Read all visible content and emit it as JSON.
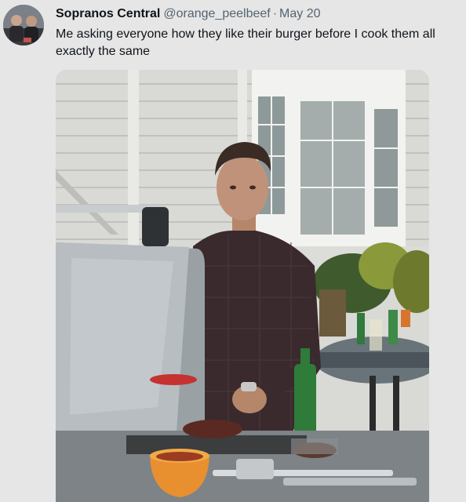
{
  "tweet": {
    "display_name": "Sopranos Central",
    "handle": "@orange_peelbeef",
    "separator": "·",
    "date": "May 20",
    "text": "Me asking everyone how they like their burger before I cook them all exactly the same"
  },
  "avatar": {
    "icon": "profile-photo-two-men"
  },
  "media": {
    "icon": "photo-man-at-grill",
    "description_colors": {
      "siding": "#dcdcd8",
      "shirt": "#3a2a2e",
      "grill": "#9aa0a4"
    }
  }
}
